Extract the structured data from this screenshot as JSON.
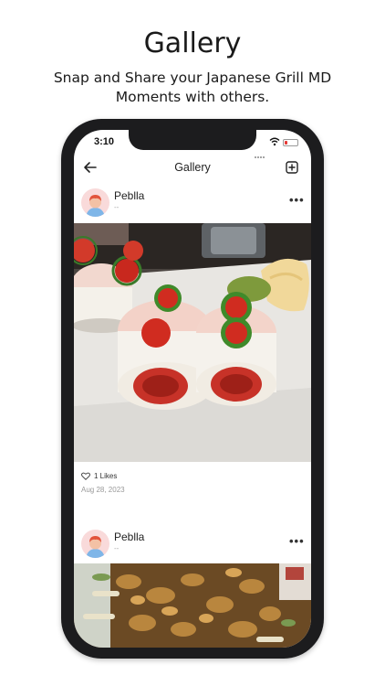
{
  "promo": {
    "title": "Gallery",
    "subtitle_line1": "Snap and Share your Japanese Grill MD",
    "subtitle_line2": "Moments with others."
  },
  "status_bar": {
    "time": "3:10",
    "battery_level": 0.25,
    "battery_color": "#e53935"
  },
  "nav": {
    "title": "Gallery",
    "back_icon": "arrow-left-icon",
    "add_icon": "plus-square-icon"
  },
  "posts": [
    {
      "author": "Peblla",
      "author_sub": "--",
      "avatar_icon": "user-avatar-icon",
      "photo": "sushi-rolls-photo",
      "likes": "1 Likes",
      "date": "Aug 28, 2023"
    },
    {
      "author": "Peblla",
      "author_sub": "--",
      "avatar_icon": "user-avatar-icon",
      "photo": "stir-fry-photo"
    }
  ],
  "colors": {
    "phone_frame": "#1c1c1e",
    "avatar_bg": "#f9dada"
  }
}
